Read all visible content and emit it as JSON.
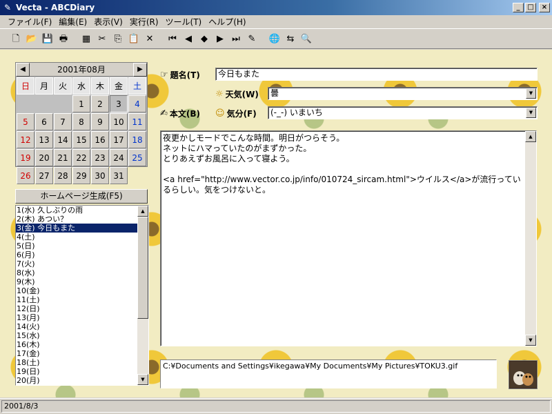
{
  "window": {
    "title": "Vecta - ABCDiary",
    "minimize": "_",
    "maximize": "□",
    "close": "×"
  },
  "menu": [
    {
      "label": "ファイル(F)"
    },
    {
      "label": "編集(E)"
    },
    {
      "label": "表示(V)"
    },
    {
      "label": "実行(R)"
    },
    {
      "label": "ツール(T)"
    },
    {
      "label": "ヘルプ(H)"
    }
  ],
  "toolbar": [
    {
      "name": "new-icon",
      "glyph": "🗋"
    },
    {
      "name": "open-icon",
      "glyph": "📂"
    },
    {
      "name": "save-icon",
      "glyph": "💾"
    },
    {
      "name": "print-icon",
      "glyph": "🖶"
    },
    {
      "name": "sep"
    },
    {
      "name": "image-icon",
      "glyph": "▦"
    },
    {
      "name": "cut-icon",
      "glyph": "✂"
    },
    {
      "name": "copy-icon",
      "glyph": "⎘"
    },
    {
      "name": "paste-icon",
      "glyph": "📋"
    },
    {
      "name": "delete-icon",
      "glyph": "✕"
    },
    {
      "name": "sep"
    },
    {
      "name": "first-icon",
      "glyph": "⏮"
    },
    {
      "name": "prev-icon",
      "glyph": "◀"
    },
    {
      "name": "today-icon",
      "glyph": "◆"
    },
    {
      "name": "next-icon",
      "glyph": "▶"
    },
    {
      "name": "last-icon",
      "glyph": "⏭"
    },
    {
      "name": "edit-icon",
      "glyph": "✎"
    },
    {
      "name": "sep"
    },
    {
      "name": "globe-icon",
      "glyph": "🌐"
    },
    {
      "name": "link-icon",
      "glyph": "⇆"
    },
    {
      "name": "find-icon",
      "glyph": "🔍"
    }
  ],
  "calendar": {
    "month": "2001年08月",
    "prev": "◀",
    "next": "▶",
    "weekdays": [
      "日",
      "月",
      "火",
      "水",
      "木",
      "金",
      "土"
    ],
    "weeks": [
      [
        "",
        "",
        "",
        "1",
        "2",
        "3",
        "4"
      ],
      [
        "5",
        "6",
        "7",
        "8",
        "9",
        "10",
        "11"
      ],
      [
        "12",
        "13",
        "14",
        "15",
        "16",
        "17",
        "18"
      ],
      [
        "19",
        "20",
        "21",
        "22",
        "23",
        "24",
        "25"
      ],
      [
        "26",
        "27",
        "28",
        "29",
        "30",
        "31",
        ""
      ]
    ],
    "selected": "3"
  },
  "homepage_button": "ホームページ生成(F5)",
  "entries": [
    "1(水) 久しぶりの雨",
    "2(木) あつい？",
    "3(金) 今日もまた",
    "4(土)",
    "5(日)",
    "6(月)",
    "7(火)",
    "8(水)",
    "9(木)",
    "10(金)",
    "11(土)",
    "12(日)",
    "13(月)",
    "14(火)",
    "15(水)",
    "16(木)",
    "17(金)",
    "18(土)",
    "19(日)",
    "20(月)"
  ],
  "selected_entry": 2,
  "form": {
    "title_label": "題名(T)",
    "title_value": "今日もまた",
    "weather_label": "天気(W)",
    "weather_value": "曇",
    "body_label": "本文(B)",
    "mood_label": "気分(F)",
    "mood_value": "(-_-) いまいち",
    "body_text": "夜更かしモードでこんな時間。明日がつらそう。\nネットにハマっていたのがまずかった。\nとりあえずお風呂に入って寝よう。\n\n<a href=\"http://www.vector.co.jp/info/010724_sircam.html\">ウイルス</a>が流行っているらしい。気をつけないと。"
  },
  "image_path": "C:¥Documents and Settings¥ikegawa¥My Documents¥My Pictures¥TOKU3.gif",
  "status": "2001/8/3"
}
